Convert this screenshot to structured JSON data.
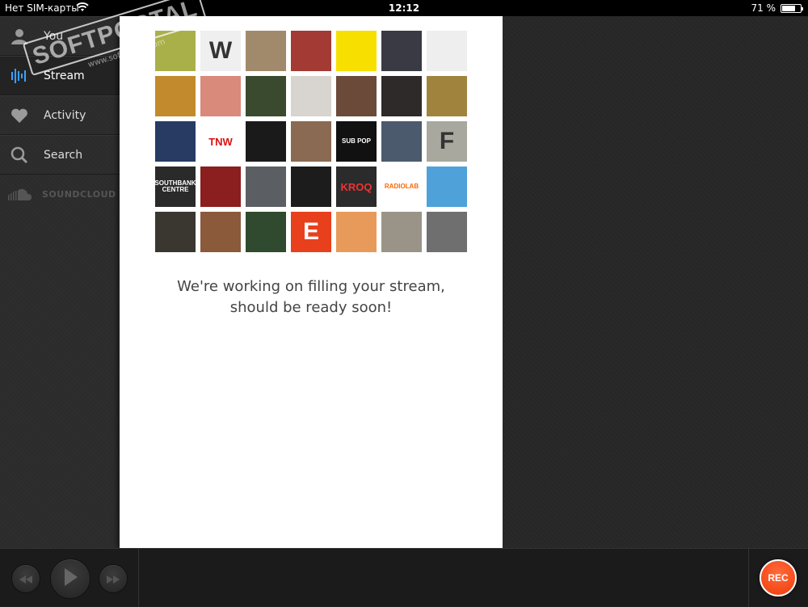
{
  "status_bar": {
    "carrier": "Нет SIM-карты",
    "time": "12:12",
    "battery": "71 %",
    "battery_level": 0.71
  },
  "sidebar": {
    "items": [
      {
        "label": "You",
        "icon": "user-icon"
      },
      {
        "label": "Stream",
        "icon": "waveform-icon"
      },
      {
        "label": "Activity",
        "icon": "heart-icon"
      },
      {
        "label": "Search",
        "icon": "search-icon"
      }
    ],
    "brand": {
      "label": "SOUNDCLOUD",
      "icon": "soundcloud-logo-icon"
    }
  },
  "stream": {
    "message_line1": "We're working on filling your stream,",
    "message_line2": "should be ready soon!",
    "tiles": [
      {
        "bg": "#a9b04a",
        "fg": "#fff",
        "text": ""
      },
      {
        "bg": "#efefef",
        "fg": "#333",
        "text": "W"
      },
      {
        "bg": "#a18a6b",
        "fg": "#fff",
        "text": ""
      },
      {
        "bg": "#a33a34",
        "fg": "#fff",
        "text": ""
      },
      {
        "bg": "#f7e000",
        "fg": "#333",
        "text": ""
      },
      {
        "bg": "#3a3a44",
        "fg": "#fff",
        "text": ""
      },
      {
        "bg": "#eeeeee",
        "fg": "#111",
        "text": ""
      },
      {
        "bg": "#c28a2c",
        "fg": "#fff",
        "text": ""
      },
      {
        "bg": "#d98a7a",
        "fg": "#fff",
        "text": ""
      },
      {
        "bg": "#3a4a2e",
        "fg": "#fff",
        "text": ""
      },
      {
        "bg": "#d8d4cf",
        "fg": "#333",
        "text": ""
      },
      {
        "bg": "#6b4a3a",
        "fg": "#fff",
        "text": ""
      },
      {
        "bg": "#2e2a2a",
        "fg": "#fff",
        "text": ""
      },
      {
        "bg": "#a0843e",
        "fg": "#fff",
        "text": ""
      },
      {
        "bg": "#273b63",
        "fg": "#fff",
        "text": ""
      },
      {
        "bg": "#ffffff",
        "fg": "#d11",
        "text": "TNW"
      },
      {
        "bg": "#1a1a1a",
        "fg": "#e33",
        "text": ""
      },
      {
        "bg": "#8a6a52",
        "fg": "#fff",
        "text": ""
      },
      {
        "bg": "#111111",
        "fg": "#fff",
        "text": "SUB POP"
      },
      {
        "bg": "#4c5a6e",
        "fg": "#fff",
        "text": ""
      },
      {
        "bg": "#a8a89e",
        "fg": "#333",
        "text": "F"
      },
      {
        "bg": "#2a2a2a",
        "fg": "#fff",
        "text": "SOUTHBANK CENTRE"
      },
      {
        "bg": "#8b1e1e",
        "fg": "#fff",
        "text": ""
      },
      {
        "bg": "#5b5e63",
        "fg": "#fff",
        "text": ""
      },
      {
        "bg": "#1c1c1c",
        "fg": "#fff",
        "text": ""
      },
      {
        "bg": "#2b2b2b",
        "fg": "#e33",
        "text": "KROQ"
      },
      {
        "bg": "#ffffff",
        "fg": "#f60",
        "text": "RADIOLAB"
      },
      {
        "bg": "#4fa1d9",
        "fg": "#fff",
        "text": ""
      },
      {
        "bg": "#3a3630",
        "fg": "#fff",
        "text": ""
      },
      {
        "bg": "#8a5a3a",
        "fg": "#fff",
        "text": ""
      },
      {
        "bg": "#2f4a2e",
        "fg": "#fff",
        "text": ""
      },
      {
        "bg": "#e8401c",
        "fg": "#fff",
        "text": "E"
      },
      {
        "bg": "#e89a5a",
        "fg": "#fff",
        "text": ""
      },
      {
        "bg": "#9a9488",
        "fg": "#fff",
        "text": ""
      },
      {
        "bg": "#6f6f6f",
        "fg": "#fff",
        "text": ""
      }
    ]
  },
  "player": {
    "prev": "previous-track-icon",
    "play": "play-icon",
    "next": "next-track-icon",
    "rec_label": "REC"
  },
  "watermark": {
    "main": "SOFTPORTAL",
    "sub": "www.softportal.com"
  }
}
